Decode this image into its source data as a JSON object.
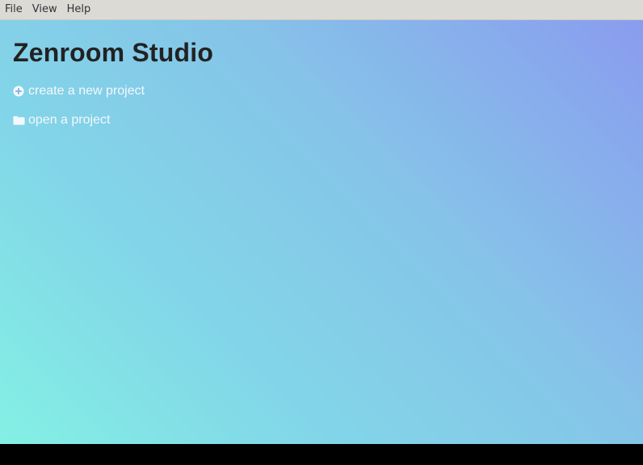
{
  "menubar": {
    "items": [
      {
        "label": "File"
      },
      {
        "label": "View"
      },
      {
        "label": "Help"
      }
    ]
  },
  "main": {
    "title": "Zenroom Studio",
    "actions": [
      {
        "label": "create a new project",
        "icon": "plus-circle-icon"
      },
      {
        "label": "open a project",
        "icon": "folder-icon"
      }
    ]
  },
  "colors": {
    "menubar_bg": "#dcdad5",
    "gradient_top_right": "#8a9cef",
    "gradient_bottom_left": "#84f0e4",
    "title_text": "#222222",
    "action_text": "#f4f8fb"
  }
}
